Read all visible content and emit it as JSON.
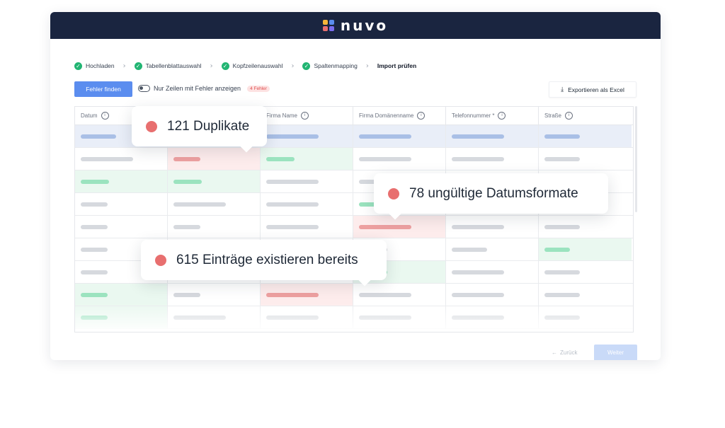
{
  "app": {
    "logo_text": "nuvo",
    "logo_colors": [
      "#f5b63a",
      "#5b8def",
      "#e86f6f",
      "#7b6df0"
    ]
  },
  "stepper": {
    "steps": [
      {
        "label": "Hochladen",
        "done": true
      },
      {
        "label": "Tabellenblattauswahl",
        "done": true
      },
      {
        "label": "Kopfzeilenauswahl",
        "done": true
      },
      {
        "label": "Spaltenmapping",
        "done": true
      },
      {
        "label": "Import prüfen",
        "done": false,
        "current": true
      }
    ]
  },
  "toolbar": {
    "find_errors_label": "Fehler finden",
    "toggle_label": "Nur Zeilen mit Fehler anzeigen",
    "toggle_on": false,
    "error_badge": "4 Fehler",
    "export_label": "Exportieren als Excel"
  },
  "table": {
    "columns": [
      "Datum",
      "Firma Name",
      "Firma Domänenname",
      "Telefonnummer *",
      "Straße"
    ],
    "column_info_icon": "info-icon"
  },
  "callouts": {
    "duplicates": "121 Duplikate",
    "date_formats": "78 ungültige Datumsformate",
    "existing": "615 Einträge existieren bereits"
  },
  "footer": {
    "back_label": "Zurück",
    "next_label": "Weiter"
  },
  "colors": {
    "brand_dark": "#1a2540",
    "primary": "#5b8def",
    "success": "#22b573",
    "error": "#e86f6f",
    "error_bg": "#fdecec",
    "success_bg": "#eaf8f0"
  }
}
